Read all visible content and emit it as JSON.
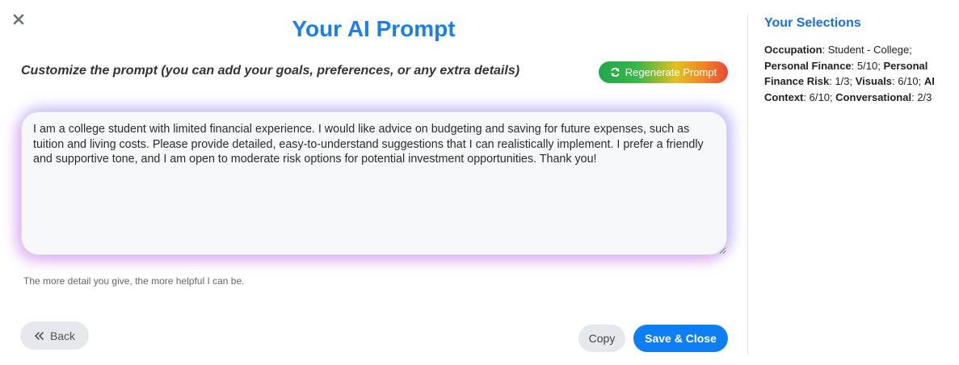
{
  "header": {
    "title": "Your AI Prompt",
    "subtitle": "Customize the prompt (you can add your goals, preferences, or any extra details)"
  },
  "toolbar": {
    "regenerate_label": "Regenerate Prompt"
  },
  "prompt": {
    "value": "I am a college student with limited financial experience. I would like advice on budgeting and saving for future expenses, such as tuition and living costs. Please provide detailed, easy-to-understand suggestions that I can realistically implement. I prefer a friendly and supportive tone, and I am open to moderate risk options for potential investment opportunities. Thank you!",
    "hint": "The more detail you give, the more helpful I can be."
  },
  "footer": {
    "back_label": "Back",
    "copy_label": "Copy",
    "save_label": "Save & Close"
  },
  "sidebar": {
    "title": "Your Selections",
    "items": [
      {
        "key": "Occupation",
        "value": "Student - College"
      },
      {
        "key": "Personal Finance",
        "value": "5/10"
      },
      {
        "key": "Personal Finance Risk",
        "value": "1/3"
      },
      {
        "key": "Visuals",
        "value": "6/10"
      },
      {
        "key": "AI Context",
        "value": "6/10"
      },
      {
        "key": "Conversational",
        "value": "2/3"
      }
    ]
  },
  "icons": {
    "close": "close-icon",
    "regenerate": "refresh-icon",
    "back": "double-chevron-left-icon"
  },
  "colors": {
    "accent": "#1a7fe6",
    "save_button": "#0d7ff2",
    "sidebar_title": "#1a6fd6"
  }
}
